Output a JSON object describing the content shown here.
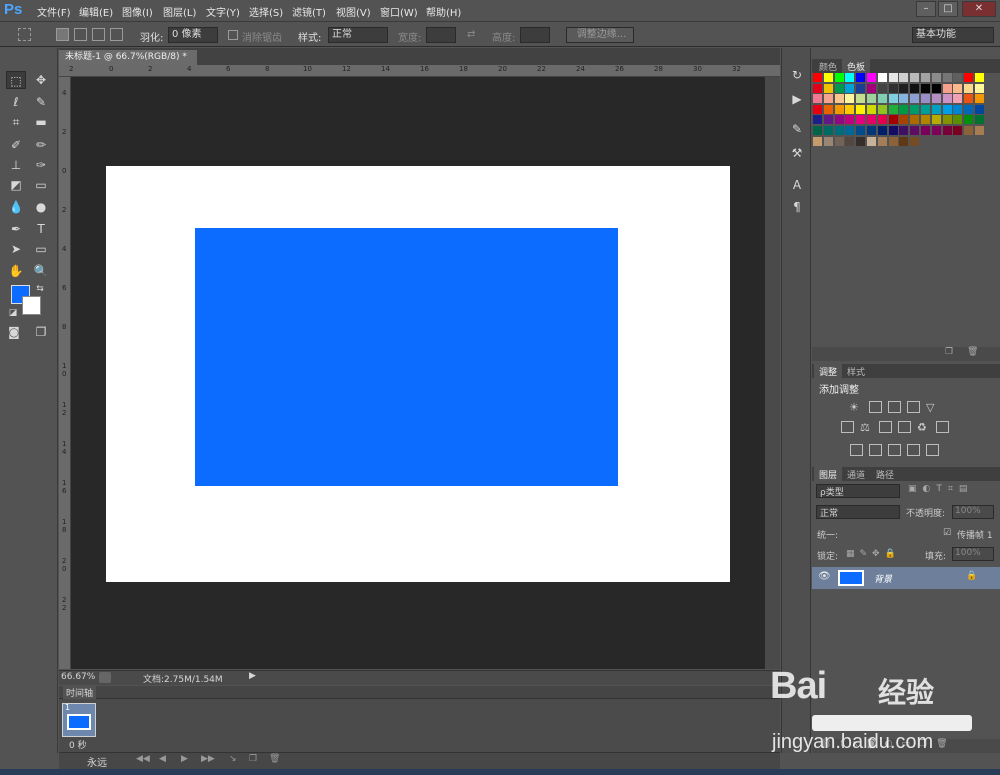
{
  "app": {
    "logo": "Ps",
    "menu": [
      "文件(F)",
      "编辑(E)",
      "图像(I)",
      "图层(L)",
      "文字(Y)",
      "选择(S)",
      "滤镜(T)",
      "视图(V)",
      "窗口(W)",
      "帮助(H)"
    ],
    "window_controls": [
      "–",
      "□",
      "✕"
    ]
  },
  "options": {
    "feather_label": "羽化:",
    "feather_value": "0 像素",
    "antialias_label": "消除锯齿",
    "style_label": "样式:",
    "style_value": "正常",
    "width_label": "宽度:",
    "height_label": "高度:",
    "refine_edge": "调整边缘...",
    "workspace": "基本功能"
  },
  "document": {
    "tab_title": "未标题-1 @ 66.7%(RGB/8) *",
    "tab_close": "×",
    "top_ruler": [
      "2",
      "0",
      "2",
      "4",
      "6",
      "8",
      "10",
      "12",
      "14",
      "16",
      "18",
      "20",
      "22",
      "24",
      "26",
      "28",
      "30",
      "32"
    ],
    "left_ruler": [
      "4",
      "2",
      "0",
      "2",
      "4",
      "6",
      "8",
      "1 0",
      "1 2",
      "1 4",
      "1 6",
      "1 8",
      "2 0",
      "2 2"
    ],
    "fill_color": "#0b6cff"
  },
  "status": {
    "zoom": "66.67%",
    "doc_info": "文档:2.75M/1.54M"
  },
  "timeline": {
    "title": "时间轴",
    "frame_number": "1",
    "frame_delay": "0 秒",
    "loop": "永远"
  },
  "panels": {
    "swatch_tabs": [
      "颜色",
      "色板"
    ],
    "adjust_tabs": [
      "调整",
      "样式"
    ],
    "adjust_title": "添加调整",
    "layers_tabs": [
      "图层",
      "通道",
      "路径"
    ],
    "filter_kind": "ρ类型",
    "blend_mode": "正常",
    "opacity_label": "不透明度:",
    "opacity_value": "100%",
    "unify_label": "统一:",
    "propagate_label": "传播帧 1",
    "lock_label": "锁定:",
    "fill_label": "填充:",
    "fill_value": "100%",
    "layer_name": "背景"
  },
  "watermark": {
    "brand": "Bai",
    "brand2": "经验",
    "url": "jingyan.baidu.com"
  },
  "swatches": [
    [
      "#ff0000",
      "#ffff00",
      "#00ff00",
      "#00ffff",
      "#0000ff",
      "#ff00ff",
      "#ffffff",
      "#e6e6e6",
      "#d0d0d0",
      "#b9b9b9",
      "#a3a3a3",
      "#8c8c8c",
      "#767676",
      "#5f5f5f",
      "#ff0000",
      "#ffff00"
    ],
    [
      "#e3001b",
      "#f0c300",
      "#009a4e",
      "#00a1d9",
      "#1c3f94",
      "#a3007c",
      "#434343",
      "#303030",
      "#1f1f1f",
      "#111111",
      "#050505",
      "#000000",
      "#f7a08c",
      "#f9b98d",
      "#fcd88f",
      "#fff799"
    ],
    [
      "#ef7a8f",
      "#f5a38a",
      "#fbc58f",
      "#fff59d",
      "#c6df8c",
      "#9ed29c",
      "#80cfb3",
      "#7fcfe0",
      "#84b4e0",
      "#8d9fd1",
      "#998ec5",
      "#b38ec5",
      "#cf92c5",
      "#f2a0b4",
      "#ea5514",
      "#f39800"
    ],
    [
      "#e60012",
      "#eb6100",
      "#f39800",
      "#fcc800",
      "#fff100",
      "#cfdb00",
      "#8fc31f",
      "#22ac38",
      "#009944",
      "#009b6b",
      "#009e96",
      "#00a0c1",
      "#00a0e9",
      "#0086d1",
      "#0068b7",
      "#00479d"
    ],
    [
      "#1d2088",
      "#601986",
      "#920783",
      "#be0081",
      "#e4007f",
      "#e5006a",
      "#e5004f",
      "#a40000",
      "#a84200",
      "#ac6a00",
      "#b28500",
      "#b7aa00",
      "#849400",
      "#5b8f00",
      "#008e0c",
      "#007130"
    ],
    [
      "#006548",
      "#006b63",
      "#006c7c",
      "#00699a",
      "#004c8c",
      "#00387a",
      "#001f69",
      "#120c64",
      "#3f0f64",
      "#5f0c63",
      "#7a005c",
      "#7e005a",
      "#790038",
      "#7a0021",
      "#8c6239",
      "#a67c52"
    ],
    [
      "#c69c6d",
      "#998675",
      "#736357",
      "#534741",
      "#362e2b",
      "#c7b299",
      "#a37e58",
      "#8c6239",
      "#603813",
      "#754c24"
    ]
  ]
}
